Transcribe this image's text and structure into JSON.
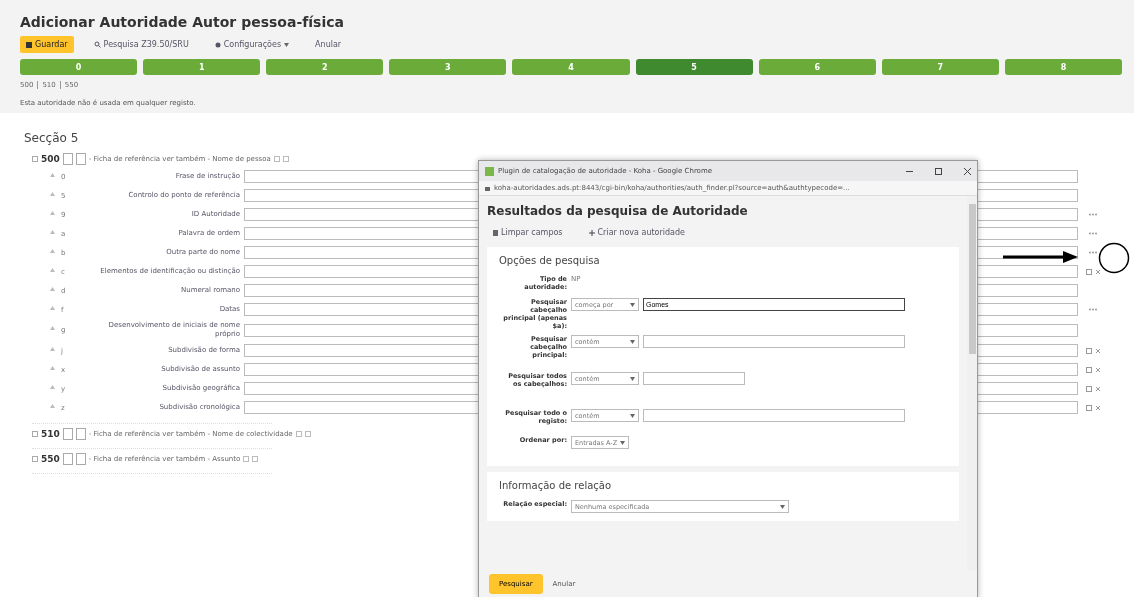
{
  "page": {
    "title": "Adicionar Autoridade Autor pessoa-física",
    "toolbar": [
      {
        "kind": "primary",
        "label": "Guardar"
      },
      {
        "kind": "search",
        "label": "Pesquisa Z39.50/SRU"
      },
      {
        "kind": "menu",
        "label": "Configurações"
      },
      {
        "kind": "link",
        "label": "Anular"
      }
    ],
    "tabs": [
      {
        "label": "0",
        "selected": false
      },
      {
        "label": "1",
        "selected": false
      },
      {
        "label": "2",
        "selected": false
      },
      {
        "label": "3",
        "selected": false
      },
      {
        "label": "4",
        "selected": false
      },
      {
        "label": "5",
        "selected": true
      },
      {
        "label": "6",
        "selected": false
      },
      {
        "label": "7",
        "selected": false
      },
      {
        "label": "8",
        "selected": false
      }
    ],
    "field_links": [
      "500",
      "510",
      "550"
    ],
    "notice": "Esta autoridade não é usada em qualquer registo."
  },
  "section": {
    "title": "Secção 5",
    "fields": [
      {
        "tag": "500",
        "description": "- Ficha de referência ver também - Nome de pessoa",
        "subfields": [
          {
            "code": "0",
            "label": "Frase de instrução",
            "kind": "plain"
          },
          {
            "code": "5",
            "label": "Controlo do ponto de referência",
            "kind": "plain"
          },
          {
            "code": "9",
            "label": "ID Autoridade",
            "kind": "plugin"
          },
          {
            "code": "a",
            "label": "Palavra de ordem",
            "kind": "plugin"
          },
          {
            "code": "b",
            "label": "Outra parte do nome",
            "kind": "plugin"
          },
          {
            "code": "c",
            "label": "Elementos de identificação ou distinção",
            "kind": "repeatable"
          },
          {
            "code": "d",
            "label": "Numeral romano",
            "kind": "plain"
          },
          {
            "code": "f",
            "label": "Datas",
            "kind": "plugin"
          },
          {
            "code": "g",
            "label": "Desenvolvimento de iniciais de nome próprio",
            "kind": "plain"
          },
          {
            "code": "j",
            "label": "Subdivisão de forma",
            "kind": "repeatable"
          },
          {
            "code": "x",
            "label": "Subdivisão de assunto",
            "kind": "repeatable"
          },
          {
            "code": "y",
            "label": "Subdivisão geográfica",
            "kind": "repeatable"
          },
          {
            "code": "z",
            "label": "Subdivisão cronológica",
            "kind": "repeatable"
          }
        ]
      },
      {
        "tag": "510",
        "description": "- Ficha de referência ver também - Nome de colectividade"
      },
      {
        "tag": "550",
        "description": "- Ficha de referência ver também - Assunto"
      }
    ]
  },
  "popup": {
    "window_title": "Plugin de catalogação de autoridade - Koha - Google Chrome",
    "url": "koha-autoridades.ads.pt:8443/cgi-bin/koha/authorities/auth_finder.pl?source=auth&authtypecode=...",
    "heading": "Resultados da pesquisa de Autoridade",
    "toolbar": [
      {
        "kind": "clear",
        "label": "Limpar campos"
      },
      {
        "kind": "new",
        "label": "Criar nova autoridade"
      }
    ],
    "options_title": "Opções de pesquisa",
    "options": [
      {
        "kind": "value",
        "label": "Tipo de autoridade:",
        "value": "NP"
      },
      {
        "kind": "search-long",
        "label": "Pesquisar cabeçalho principal (apenas $a):",
        "operator": "começa por",
        "value": "Gomes"
      },
      {
        "kind": "search-long",
        "label": "Pesquisar cabeçalho principal:",
        "operator": "contém"
      },
      {
        "kind": "search-short",
        "label": "Pesquisar todos os cabeçalhos:",
        "operator": "contém"
      },
      {
        "kind": "search-long",
        "label": "Pesquisar todo o registo:",
        "operator": "contém"
      },
      {
        "kind": "select",
        "label": "Ordenar por:",
        "value": "Entradas A-Z"
      }
    ],
    "relation_title": "Informação de relação",
    "relation": {
      "label": "Relação especial:",
      "value": "Nenhuma especificada"
    },
    "submit": "Pesquisar",
    "cancel": "Anular"
  }
}
